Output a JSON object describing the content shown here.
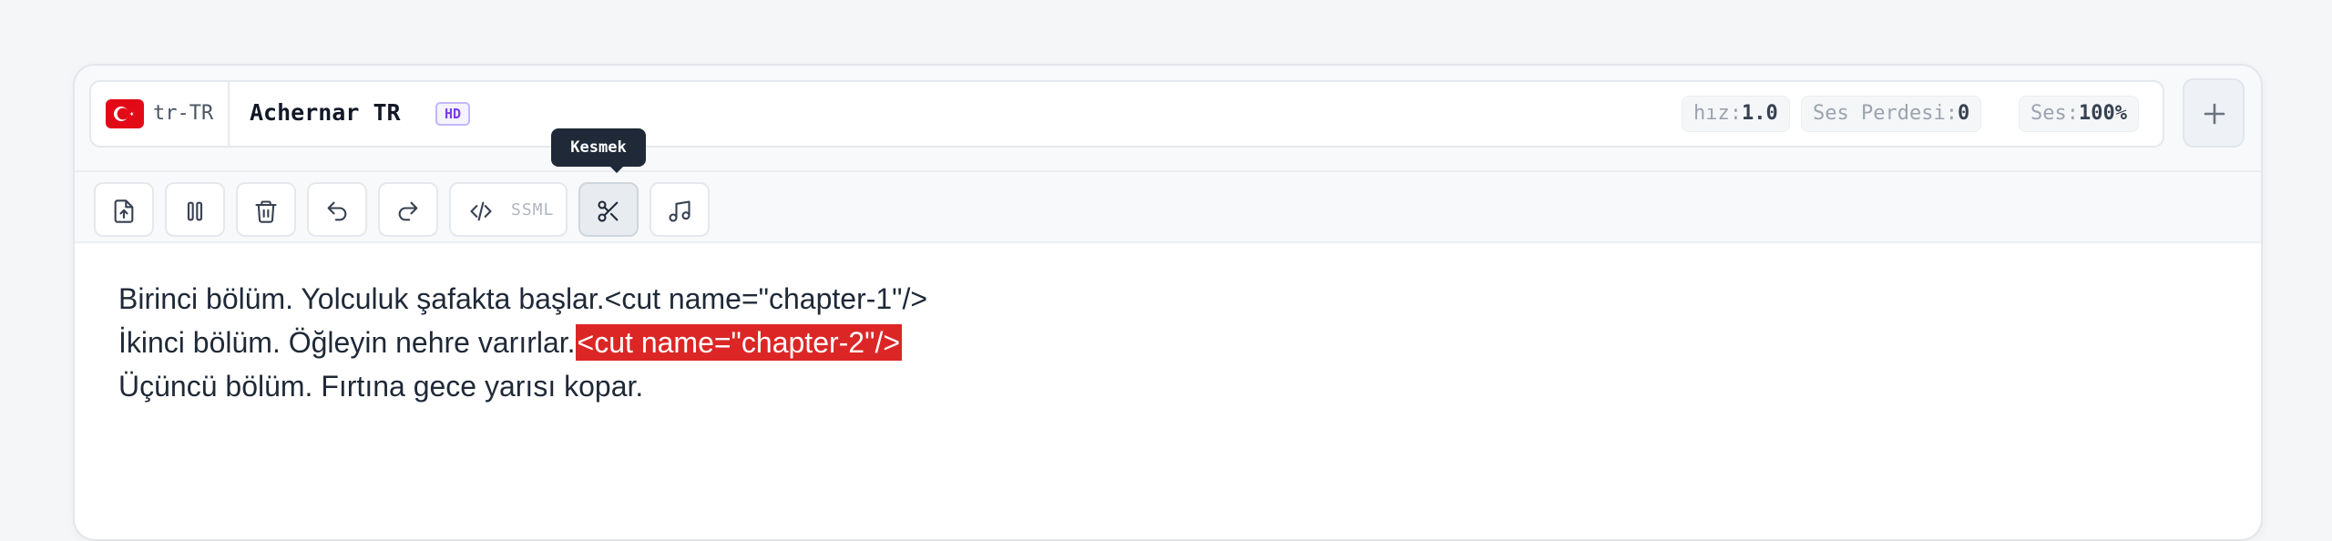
{
  "header": {
    "locale": "tr-TR",
    "voice_name": "Achernar TR",
    "quality_badge": "HD",
    "params": {
      "speed_label": "hız:",
      "speed_value": "1.0",
      "pitch_label": "Ses Perdesi:",
      "pitch_value": "0",
      "volume_label": "Ses:",
      "volume_value": "100%"
    },
    "add_icon": "plus-icon"
  },
  "toolbar": {
    "buttons": [
      {
        "name": "upload-file-button",
        "icon": "file-upload-icon"
      },
      {
        "name": "pause-button",
        "icon": "pause-icon"
      },
      {
        "name": "delete-button",
        "icon": "trash-icon"
      },
      {
        "name": "undo-button",
        "icon": "undo-icon"
      },
      {
        "name": "redo-button",
        "icon": "redo-icon"
      },
      {
        "name": "ssml-button",
        "icon": "code-icon",
        "label": "SSML"
      },
      {
        "name": "cut-button",
        "icon": "scissors-icon",
        "active": true
      },
      {
        "name": "music-button",
        "icon": "music-note-icon"
      }
    ],
    "tooltip": "Kesmek"
  },
  "editor": {
    "lines": [
      {
        "text": "Birinci bölüm. Yolculuk şafakta başlar.",
        "tag": "<cut name=\"chapter-1\"/>"
      },
      {
        "text": "İkinci bölüm. Öğleyin nehre varırlar.",
        "tag": "<cut name=\"chapter-2\"/>"
      },
      {
        "text": "Üçüncü bölüm. Fırtına gece yarısı kopar.",
        "tag": ""
      }
    ],
    "highlight_color": "#dc2626"
  },
  "colors": {
    "flag_red": "#e30a17",
    "badge_purple": "#7c3aed",
    "tooltip_bg": "#1f2937"
  }
}
